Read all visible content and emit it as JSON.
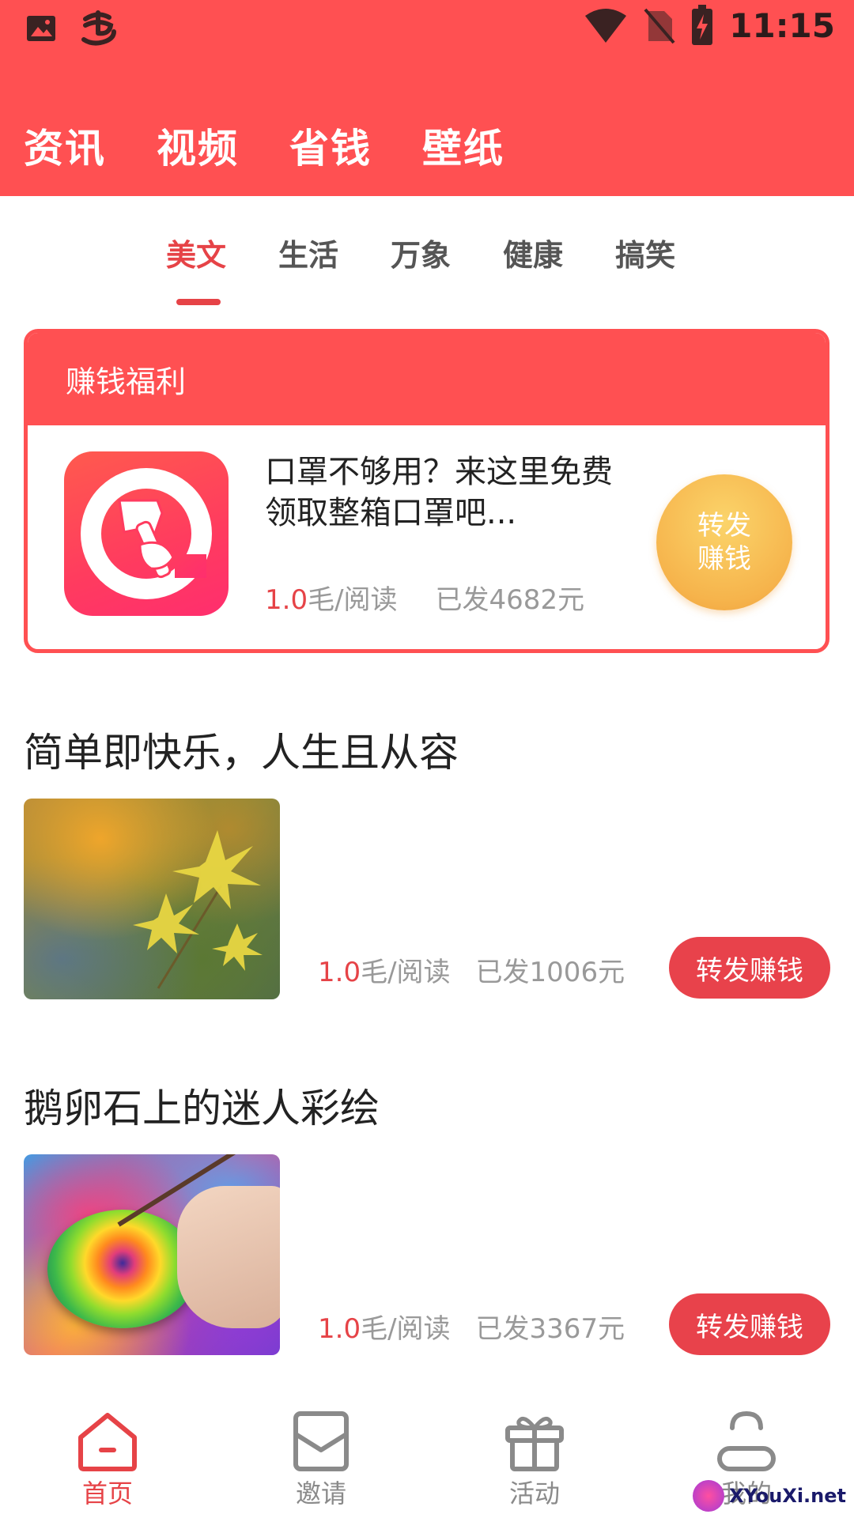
{
  "status_bar": {
    "time": "11:15",
    "left_icons": [
      "image-icon",
      "app-logo-icon"
    ],
    "right_icons": [
      "wifi-icon",
      "no-sim-icon",
      "battery-charging-icon"
    ]
  },
  "top_tabs": [
    {
      "label": "资讯",
      "active": true
    },
    {
      "label": "视频",
      "active": false
    },
    {
      "label": "省钱",
      "active": false
    },
    {
      "label": "壁纸",
      "active": false
    }
  ],
  "sub_tabs": [
    {
      "label": "美文",
      "active": true
    },
    {
      "label": "生活",
      "active": false
    },
    {
      "label": "万象",
      "active": false
    },
    {
      "label": "健康",
      "active": false
    },
    {
      "label": "搞笑",
      "active": false
    }
  ],
  "welfare": {
    "header": "赚钱福利",
    "title": "口罩不够用？来这里免费领取整箱口罩吧...",
    "rate_value": "1.0",
    "rate_unit": "毛/阅读",
    "paid": "已发4682元",
    "button": "转发赚钱"
  },
  "articles": [
    {
      "title": "简单即快乐，人生且从容",
      "thumb": "maple-leaves-photo",
      "rate_value": "1.0",
      "rate_unit": "毛/阅读",
      "paid": "已发1006元",
      "button": "转发赚钱"
    },
    {
      "title": "鹅卵石上的迷人彩绘",
      "thumb": "painted-pebble-photo",
      "rate_value": "1.0",
      "rate_unit": "毛/阅读",
      "paid": "已发3367元",
      "button": "转发赚钱"
    }
  ],
  "bottom_nav": [
    {
      "label": "首页",
      "icon": "home-icon",
      "active": true
    },
    {
      "label": "邀请",
      "icon": "envelope-icon",
      "active": false
    },
    {
      "label": "活动",
      "icon": "gift-icon",
      "active": false
    },
    {
      "label": "我的",
      "icon": "profile-icon",
      "active": false
    }
  ],
  "watermark": "XYouXi.net",
  "colors": {
    "brand": "#ff5052",
    "accent": "#e64347",
    "gold": "#f6b44c",
    "muted": "#999999"
  }
}
